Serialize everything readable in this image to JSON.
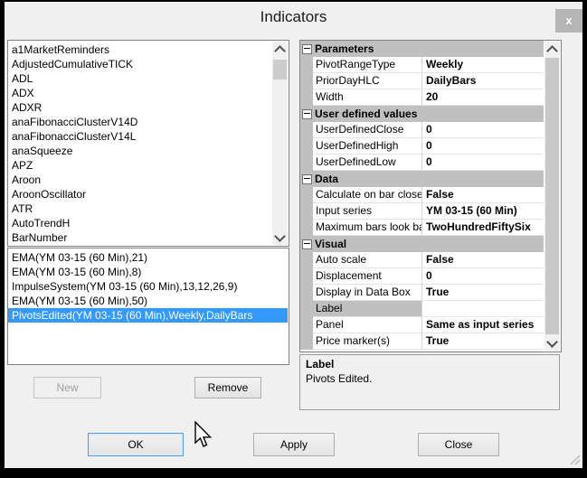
{
  "window": {
    "title": "Indicators",
    "close_glyph": "x"
  },
  "colors": {
    "selection": "#3399ff",
    "category_bg": "#c0c0c0",
    "dialog_bg": "#f0f0f0"
  },
  "indicator_list": {
    "items": [
      "a1MarketReminders",
      "AdjustedCumulativeTICK",
      "ADL",
      "ADX",
      "ADXR",
      "anaFibonacciClusterV14D",
      "anaFibonacciClusterV14L",
      "anaSqueeze",
      "APZ",
      "Aroon",
      "AroonOscillator",
      "ATR",
      "AutoTrendH",
      "BarNumber"
    ]
  },
  "applied_list": {
    "items": [
      "EMA(YM 03-15 (60 Min),21)",
      "EMA(YM 03-15 (60 Min),8)",
      "ImpulseSystem(YM 03-15 (60 Min),13,12,26,9)",
      "EMA(YM 03-15 (60 Min),50)",
      "PivotsEdited(YM 03-15 (60 Min),Weekly,DailyBars"
    ],
    "selected_index": 4
  },
  "property_grid": {
    "rows": [
      {
        "type": "category",
        "label": "Parameters"
      },
      {
        "type": "property",
        "label": "PivotRangeType",
        "value": "Weekly"
      },
      {
        "type": "property",
        "label": "PriorDayHLC",
        "value": "DailyBars"
      },
      {
        "type": "property",
        "label": "Width",
        "value": "20"
      },
      {
        "type": "category",
        "label": "User defined values"
      },
      {
        "type": "property",
        "label": "UserDefinedClose",
        "value": "0"
      },
      {
        "type": "property",
        "label": "UserDefinedHigh",
        "value": "0"
      },
      {
        "type": "property",
        "label": "UserDefinedLow",
        "value": "0"
      },
      {
        "type": "category",
        "label": "Data"
      },
      {
        "type": "property",
        "label": "Calculate on bar close",
        "value": "False"
      },
      {
        "type": "property",
        "label": "Input series",
        "value": "YM 03-15 (60 Min)"
      },
      {
        "type": "property",
        "label": "Maximum bars look ba",
        "value": "TwoHundredFiftySix"
      },
      {
        "type": "category",
        "label": "Visual"
      },
      {
        "type": "property",
        "label": "Auto scale",
        "value": "False"
      },
      {
        "type": "property",
        "label": "Displacement",
        "value": "0"
      },
      {
        "type": "property",
        "label": "Display in Data Box",
        "value": "True"
      },
      {
        "type": "property",
        "label": "Label",
        "value": "",
        "selected": true
      },
      {
        "type": "property",
        "label": "Panel",
        "value": "Same as input series"
      },
      {
        "type": "property",
        "label": "Price marker(s)",
        "value": "True"
      }
    ]
  },
  "description": {
    "title": "Label",
    "text": "Pivots Edited."
  },
  "buttons": {
    "new": "New",
    "remove": "Remove",
    "ok": "OK",
    "apply": "Apply",
    "close": "Close"
  }
}
